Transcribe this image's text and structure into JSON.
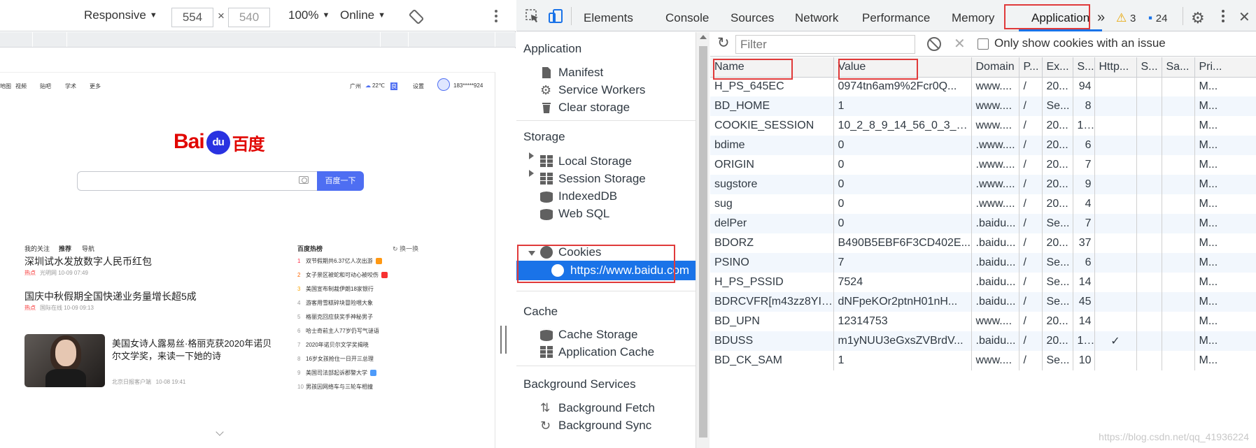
{
  "device_toolbar": {
    "device": "Responsive",
    "width": "554",
    "times": "×",
    "height": "540",
    "zoom": "100%",
    "network": "Online"
  },
  "baidu": {
    "top_links": [
      "地图",
      "视频",
      "贴吧",
      "学术",
      "更多"
    ],
    "weather": "广州",
    "temp": "22℃",
    "settings": "设置",
    "user": "183*****924",
    "logo_bai": "Bai",
    "logo_du": "du",
    "logo_cn": "百度",
    "search_button": "百度一下",
    "feed_tabs": [
      "我的关注",
      "推荐",
      "导航"
    ],
    "hot_title": "百度热榜",
    "hot_refresh": "换一换",
    "news": [
      {
        "title": "深圳试水发放数字人民币红包",
        "source": "热点",
        "site": "光明网",
        "time": "10-09 07:49"
      },
      {
        "title": "国庆中秋假期全国快递业务量增长超5成",
        "source": "热点",
        "site": "国际在线",
        "time": "10-09 09:13"
      },
      {
        "title": "美国女诗人露易丝·格丽克获2020年诺贝",
        "title2": "尔文学奖，来读一下她的诗",
        "site": "北京日报客户端",
        "time": "10-08 19:41"
      }
    ],
    "hot_list": [
      {
        "rank": "1",
        "text": "双节假期共6.37亿人次出游"
      },
      {
        "rank": "2",
        "text": "女子景区被蛇和可动心被咬伤"
      },
      {
        "rank": "3",
        "text": "美国宣布制裁伊朗18家银行"
      },
      {
        "rank": "4",
        "text": "游客用雪糕碎块冒险喂大象"
      },
      {
        "rank": "5",
        "text": "格丽克回应获奖手神秘男子"
      },
      {
        "rank": "6",
        "text": "哈士奇前主人77岁仍写气谜语"
      },
      {
        "rank": "7",
        "text": "2020年诺贝尔文学奖揭晓"
      },
      {
        "rank": "8",
        "text": "16岁女孩抢住一日开三总理"
      },
      {
        "rank": "9",
        "text": "美国司法部起诉郡警大学"
      },
      {
        "rank": "10",
        "text": "男孩因网络车与三轮车相撞"
      }
    ]
  },
  "devtools": {
    "tabs": [
      "Elements",
      "Console",
      "Sources",
      "Network",
      "Performance",
      "Memory",
      "Application"
    ],
    "active_tab": "Application",
    "more_tabs": "»",
    "warnings": "3",
    "messages": "24",
    "highlight_color": "#e03a3a",
    "accent_color": "#1a73e8",
    "sidebar": {
      "application_header": "Application",
      "application_items": [
        "Manifest",
        "Service Workers",
        "Clear storage"
      ],
      "storage_header": "Storage",
      "storage_items": [
        "Local Storage",
        "Session Storage",
        "IndexedDB",
        "Web SQL",
        "Cookies"
      ],
      "cookie_origin": "https://www.baidu.com",
      "cache_header": "Cache",
      "cache_items": [
        "Cache Storage",
        "Application Cache"
      ],
      "background_header": "Background Services",
      "background_items": [
        "Background Fetch",
        "Background Sync"
      ]
    },
    "filter": {
      "placeholder": "Filter",
      "checkbox_label": "Only show cookies with an issue"
    },
    "columns": [
      "Name",
      "Value",
      "Domain",
      "P...",
      "Ex...",
      "S...",
      "Http...",
      "S...",
      "Sa...",
      "Pri..."
    ],
    "cookies": [
      {
        "name": "H_PS_645EC",
        "value": "0974tn6am9%2Fcr0Q...",
        "domain": "www....",
        "path": "/",
        "expires": "20...",
        "size": "94",
        "http": "",
        "secure": "",
        "samesite": "",
        "priority": "M..."
      },
      {
        "name": "BD_HOME",
        "value": "1",
        "domain": "www....",
        "path": "/",
        "expires": "Se...",
        "size": "8",
        "http": "",
        "secure": "",
        "samesite": "",
        "priority": "M..."
      },
      {
        "name": "COOKIE_SESSION",
        "value": "10_2_8_9_14_56_0_3_8...",
        "domain": "www....",
        "path": "/",
        "expires": "20...",
        "size": "1...",
        "http": "",
        "secure": "",
        "samesite": "",
        "priority": "M..."
      },
      {
        "name": "bdime",
        "value": "0",
        "domain": ".www....",
        "path": "/",
        "expires": "20...",
        "size": "6",
        "http": "",
        "secure": "",
        "samesite": "",
        "priority": "M..."
      },
      {
        "name": "ORIGIN",
        "value": "0",
        "domain": ".www....",
        "path": "/",
        "expires": "20...",
        "size": "7",
        "http": "",
        "secure": "",
        "samesite": "",
        "priority": "M..."
      },
      {
        "name": "sugstore",
        "value": "0",
        "domain": ".www....",
        "path": "/",
        "expires": "20...",
        "size": "9",
        "http": "",
        "secure": "",
        "samesite": "",
        "priority": "M..."
      },
      {
        "name": "sug",
        "value": "0",
        "domain": ".www....",
        "path": "/",
        "expires": "20...",
        "size": "4",
        "http": "",
        "secure": "",
        "samesite": "",
        "priority": "M..."
      },
      {
        "name": "delPer",
        "value": "0",
        "domain": ".baidu...",
        "path": "/",
        "expires": "Se...",
        "size": "7",
        "http": "",
        "secure": "",
        "samesite": "",
        "priority": "M..."
      },
      {
        "name": "BDORZ",
        "value": "B490B5EBF6F3CD402E...",
        "domain": ".baidu...",
        "path": "/",
        "expires": "20...",
        "size": "37",
        "http": "",
        "secure": "",
        "samesite": "",
        "priority": "M..."
      },
      {
        "name": "PSINO",
        "value": "7",
        "domain": ".baidu...",
        "path": "/",
        "expires": "Se...",
        "size": "6",
        "http": "",
        "secure": "",
        "samesite": "",
        "priority": "M..."
      },
      {
        "name": "H_PS_PSSID",
        "value": "7524",
        "domain": ".baidu...",
        "path": "/",
        "expires": "Se...",
        "size": "14",
        "http": "",
        "secure": "",
        "samesite": "",
        "priority": "M..."
      },
      {
        "name": "BDRCVFR[m43zz8YI_...",
        "value": "dNFpeKOr2ptnH01nH...",
        "domain": ".baidu...",
        "path": "/",
        "expires": "Se...",
        "size": "45",
        "http": "",
        "secure": "",
        "samesite": "",
        "priority": "M..."
      },
      {
        "name": "BD_UPN",
        "value": "12314753",
        "domain": "www....",
        "path": "/",
        "expires": "20...",
        "size": "14",
        "http": "",
        "secure": "",
        "samesite": "",
        "priority": "M..."
      },
      {
        "name": "BDUSS",
        "value": "m1yNUU3eGxsZVBrdV...",
        "domain": ".baidu...",
        "path": "/",
        "expires": "20...",
        "size": "1...",
        "http": "✓",
        "secure": "",
        "samesite": "",
        "priority": "M..."
      },
      {
        "name": "BD_CK_SAM",
        "value": "1",
        "domain": "www....",
        "path": "/",
        "expires": "Se...",
        "size": "10",
        "http": "",
        "secure": "",
        "samesite": "",
        "priority": "M..."
      }
    ]
  },
  "watermark": "https://blog.csdn.net/qq_41936224"
}
